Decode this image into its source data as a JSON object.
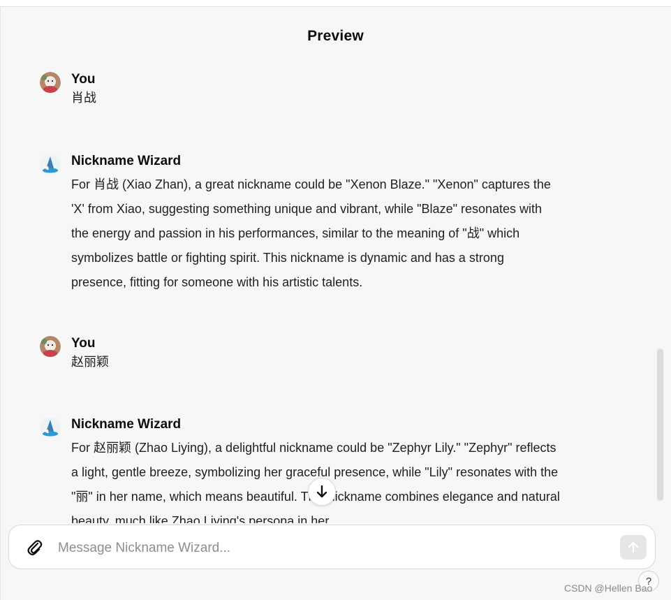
{
  "header": {
    "title": "Preview"
  },
  "messages": [
    {
      "author": "You",
      "text": "肖战"
    },
    {
      "author": "Nickname Wizard",
      "text": "For 肖战 (Xiao Zhan), a great nickname could be \"Xenon Blaze.\" \"Xenon\" captures the 'X' from Xiao, suggesting something unique and vibrant, while \"Blaze\" resonates with the energy and passion in his performances, similar to the meaning of \"战\" which symbolizes battle or fighting spirit. This nickname is dynamic and has a strong presence, fitting for someone with his artistic talents."
    },
    {
      "author": "You",
      "text": "赵丽颖"
    },
    {
      "author": "Nickname Wizard",
      "text": "For 赵丽颖 (Zhao Liying), a delightful nickname could be \"Zephyr Lily.\" \"Zephyr\" reflects a light, gentle breeze, symbolizing her graceful presence, while \"Lily\" resonates with the \"丽\" in her name, which means beautiful. This nickname combines elegance and natural beauty, much like Zhao Liying's persona in her"
    }
  ],
  "composer": {
    "placeholder": "Message Nickname Wizard..."
  },
  "watermark": "CSDN @Hellen Bao",
  "help": "?"
}
